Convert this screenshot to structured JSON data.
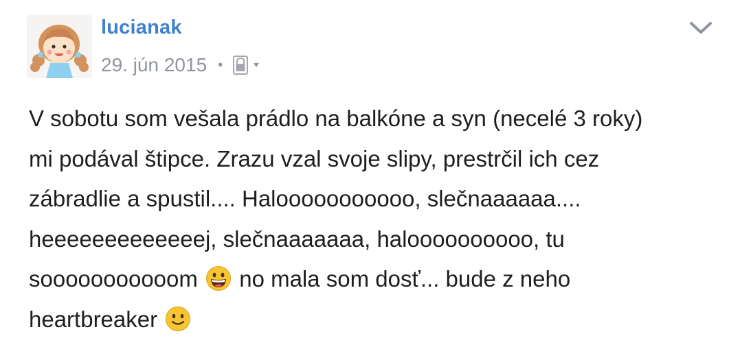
{
  "post": {
    "author": "lucianak",
    "date": "29. jún 2015",
    "separator": "•",
    "privacy_icon": "lock-icon",
    "menu_icon": "chevron-down-icon",
    "body_lines": [
      {
        "text": "V sobotu som vešala prádlo na balkóne a syn (necelé 3 roky)"
      },
      {
        "text": "mi podával štipce. Zrazu vzal svoje slipy, prestrčil ich cez"
      },
      {
        "text": "zábradlie a spustil.... Halooooooooooo, slečnaaaaaa...."
      },
      {
        "text": "heeeeeeeeeeeeej, slečnaaaaaaa, haloooooooooo, tu"
      },
      {
        "before": "sooooooooooom",
        "emoji": "grinning-face-emoji",
        "after": "no mala som dosť... bude z neho"
      },
      {
        "before": "heartbreaker",
        "emoji": "smiling-face-emoji",
        "after": ""
      }
    ]
  },
  "colors": {
    "username": "#4080d0",
    "meta": "#90949c",
    "text": "#1c1e21",
    "emoji_yellow": "#f7c531"
  }
}
